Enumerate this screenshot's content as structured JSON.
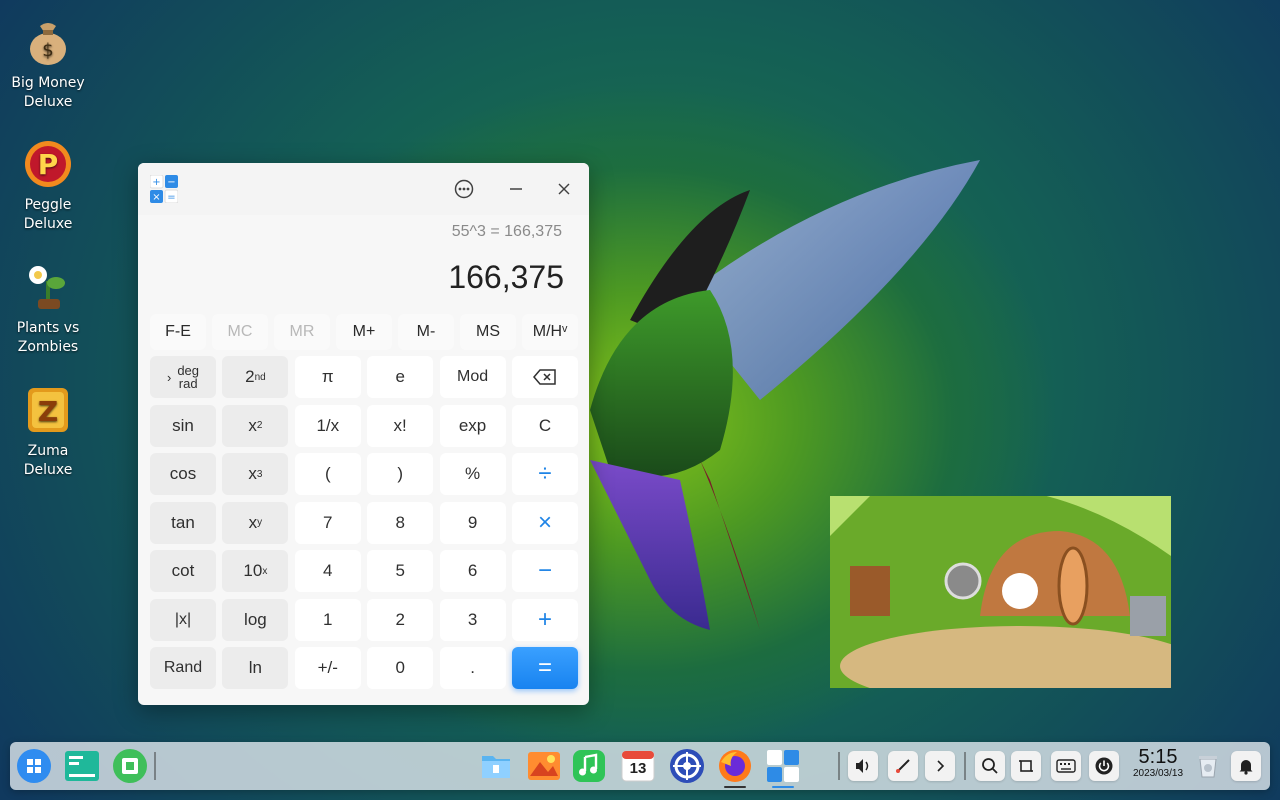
{
  "desktop": {
    "icons": [
      {
        "label": "Big Money\nDeluxe",
        "icon": "money-bag-icon"
      },
      {
        "label": "Peggle\nDeluxe",
        "icon": "peggle-icon"
      },
      {
        "label": "Plants vs\nZombies",
        "icon": "plants-icon"
      },
      {
        "label": "Zuma\nDeluxe",
        "icon": "zuma-icon"
      }
    ]
  },
  "calculator": {
    "expression": "55^3 = 166,375",
    "result": "166,375",
    "memory_buttons": [
      {
        "label": "F-E",
        "enabled": true
      },
      {
        "label": "MC",
        "enabled": false
      },
      {
        "label": "MR",
        "enabled": false
      },
      {
        "label": "M+",
        "enabled": true
      },
      {
        "label": "M-",
        "enabled": true
      },
      {
        "label": "MS",
        "enabled": true
      },
      {
        "label": "M/Hᵛ",
        "enabled": true
      }
    ],
    "keys": {
      "deg": "deg",
      "rad": "rad",
      "second": "2",
      "second_sup": "nd",
      "pi": "π",
      "e": "e",
      "mod": "Mod",
      "sin": "sin",
      "x2": "x",
      "x2_sup": "2",
      "inv": "1/x",
      "fact": "x!",
      "exp": "exp",
      "clear": "C",
      "cos": "cos",
      "x3": "x",
      "x3_sup": "3",
      "lparen": "(",
      "rparen": ")",
      "percent": "%",
      "divide": "÷",
      "tan": "tan",
      "xy": "x",
      "xy_sup": "y",
      "seven": "7",
      "eight": "8",
      "nine": "9",
      "multiply": "×",
      "cot": "cot",
      "ten": "10",
      "ten_sup": "x",
      "four": "4",
      "five": "5",
      "six": "6",
      "minus": "−",
      "abs": "|x|",
      "log": "log",
      "one": "1",
      "two": "2",
      "three": "3",
      "plus": "+",
      "rand": "Rand",
      "ln": "ln",
      "negate": "+/-",
      "zero": "0",
      "dot": ".",
      "equals": "="
    }
  },
  "taskbar": {
    "time": "5:15",
    "date": "2023/03/13",
    "calendar_day": "13"
  },
  "colors": {
    "accent": "#1f84e6",
    "equals_button": "#1883f0"
  }
}
